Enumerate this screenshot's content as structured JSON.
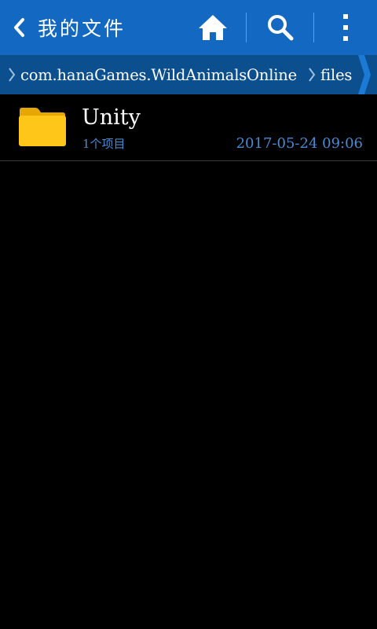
{
  "header": {
    "title": "我的文件",
    "back_icon": "chevron-left-icon",
    "actions": [
      {
        "icon": "home-icon"
      },
      {
        "icon": "search-icon"
      },
      {
        "icon": "more-vertical-icon"
      }
    ]
  },
  "breadcrumb": {
    "items": [
      {
        "label": "com.hanaGames.WildAnimalsOnline"
      },
      {
        "label": "files"
      }
    ]
  },
  "files": [
    {
      "name": "Unity",
      "count": "1个项目",
      "date": "2017-05-24 09:06",
      "icon": "folder-icon"
    }
  ],
  "colors": {
    "topbar": "#1369c2",
    "breadcrumb_bar": "#0c4f8f",
    "background": "#000000",
    "meta_text": "#4a8ad0",
    "folder": "#ffc107"
  }
}
